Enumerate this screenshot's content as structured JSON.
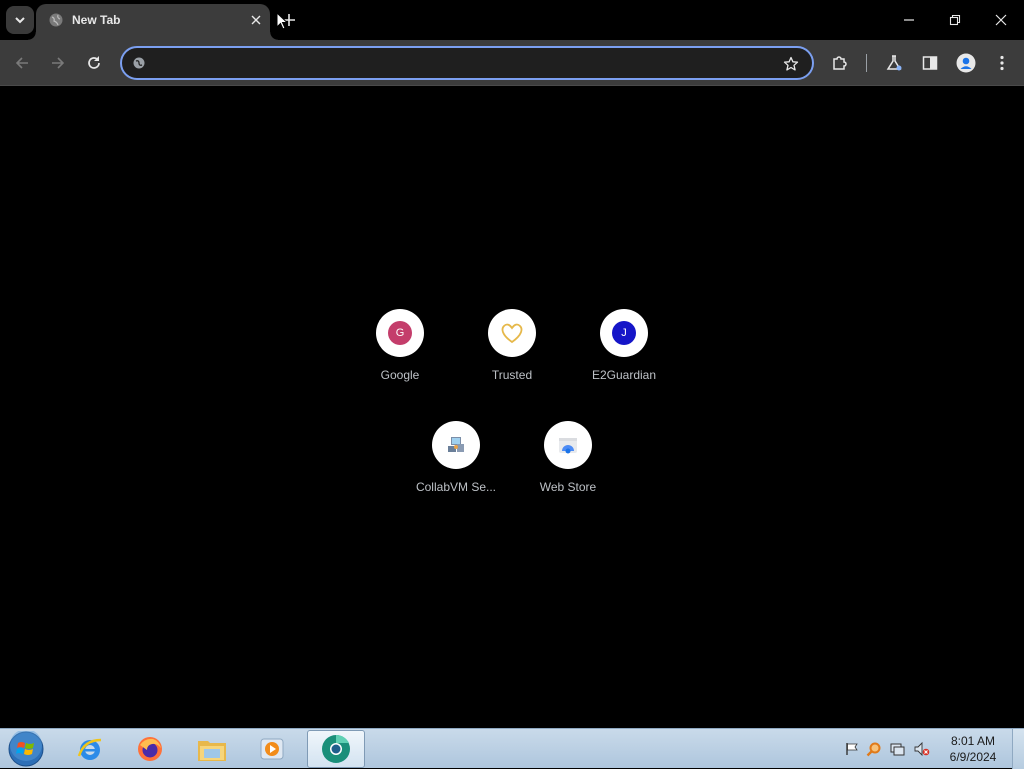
{
  "browser": {
    "tab": {
      "title": "New Tab"
    },
    "omnibox": {
      "value": "",
      "placeholder": ""
    }
  },
  "shortcuts": [
    {
      "label": "Google",
      "icon": "google-icon",
      "badge": "G",
      "color": "#c43d6b"
    },
    {
      "label": "Trusted",
      "icon": "heart-icon",
      "color": "#e6b84a"
    },
    {
      "label": "E2Guardian",
      "icon": "j-badge-icon",
      "badge": "J",
      "color": "#1515c8"
    },
    {
      "label": "CollabVM Se...",
      "icon": "collabvm-icon"
    },
    {
      "label": "Web Store",
      "icon": "web-store-icon"
    }
  ],
  "taskbar": {
    "apps": [
      "internet-explorer",
      "firefox",
      "file-explorer",
      "media-player",
      "chrome-canary"
    ],
    "clock": {
      "time": "8:01 AM",
      "date": "6/9/2024"
    }
  },
  "colors": {
    "accent": "#7b9ff0",
    "toolbar": "#3c3c3c",
    "background": "#000000"
  }
}
